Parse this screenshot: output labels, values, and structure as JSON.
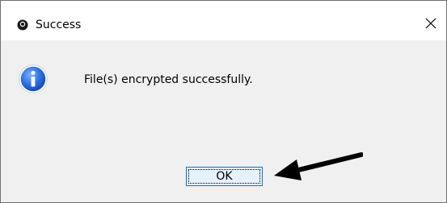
{
  "window": {
    "title": "Success",
    "app_icon": "app-logo-icon",
    "close_icon": "close-icon",
    "close_glyph": "✕"
  },
  "content": {
    "icon": "info-icon",
    "message": "File(s) encrypted successfully."
  },
  "buttons": {
    "ok_label": "OK"
  },
  "annotation": {
    "icon": "pointer-arrow-icon"
  },
  "colors": {
    "titlebar_bg": "#ffffff",
    "dialog_bg": "#f0f0f0",
    "button_bg": "#e5f1fb",
    "button_border": "#0078d7",
    "info_icon_blue": "#1f5fd0"
  }
}
